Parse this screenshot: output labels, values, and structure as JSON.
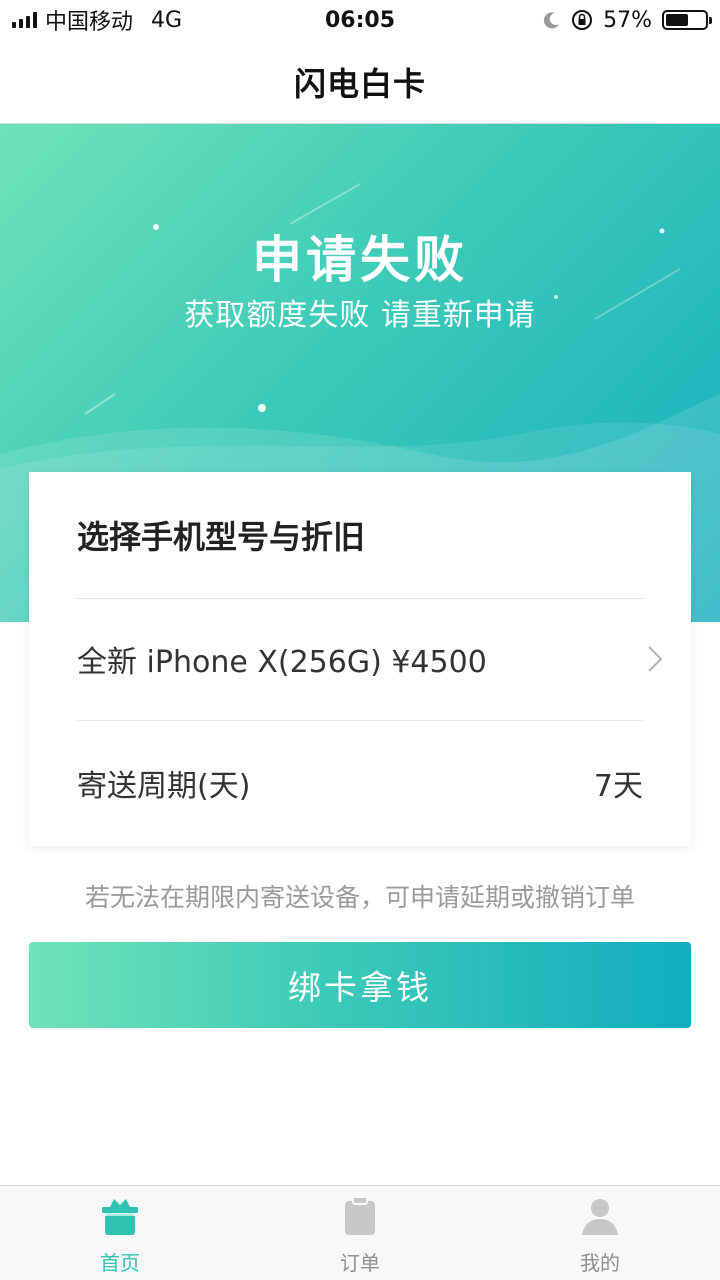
{
  "status_bar": {
    "carrier": "中国移动",
    "network": "4G",
    "time": "06:05",
    "battery_percent": "57%",
    "battery_level": 0.57
  },
  "nav": {
    "title": "闪电白卡"
  },
  "hero": {
    "title": "申请失败",
    "subtitle": "获取额度失败 请重新申请"
  },
  "card": {
    "heading": "选择手机型号与折旧",
    "phone_option": "全新 iPhone X(256G) ¥4500",
    "period_label": "寄送周期(天)",
    "period_value": "7天"
  },
  "hint": "若无法在期限内寄送设备，可申请延期或撤销订单",
  "cta_label": "绑卡拿钱",
  "tabs": [
    {
      "label": "首页",
      "icon": "home-icon",
      "active": true
    },
    {
      "label": "订单",
      "icon": "order-icon",
      "active": false
    },
    {
      "label": "我的",
      "icon": "profile-icon",
      "active": false
    }
  ],
  "colors": {
    "accent": "#2ec3b2",
    "gradient_start": "#6fe3b8",
    "gradient_end": "#12adc0",
    "inactive": "#c8c8c8"
  }
}
